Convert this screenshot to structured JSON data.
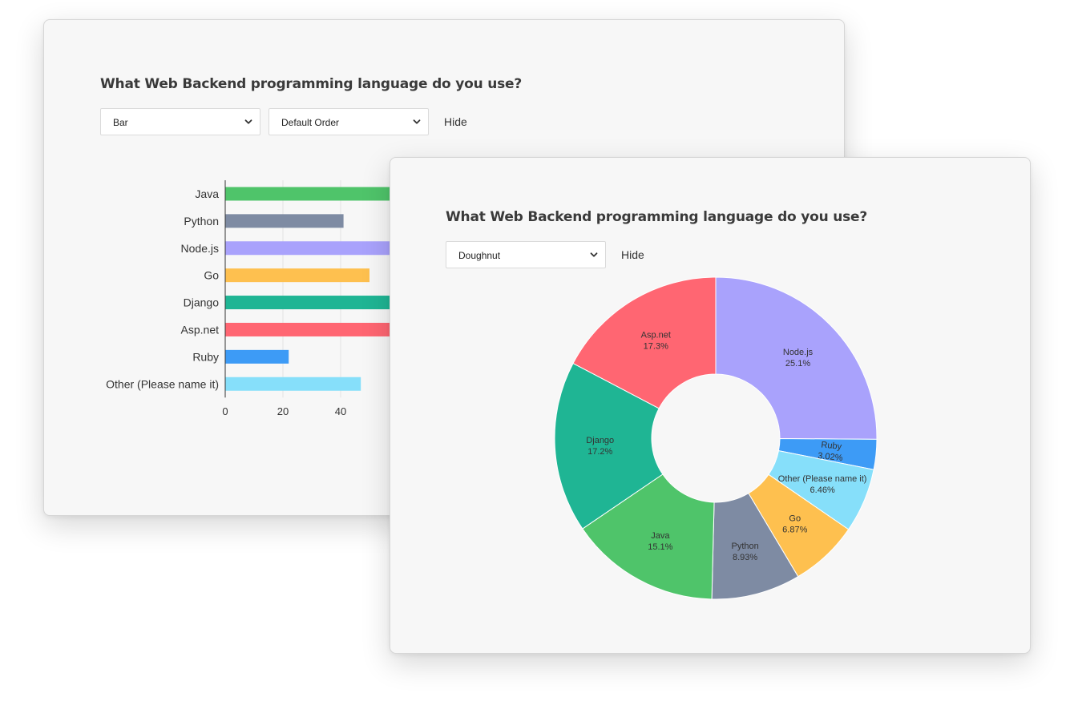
{
  "back_card": {
    "title": "What Web Backend programming language do you use?",
    "chart_type_select": {
      "value": "Bar"
    },
    "order_select": {
      "value": "Default Order"
    },
    "hide_label": "Hide"
  },
  "front_card": {
    "title": "What Web Backend programming language do you use?",
    "chart_type_select": {
      "value": "Doughnut"
    },
    "hide_label": "Hide"
  },
  "icons": {
    "select_arrow": "chevron-down-icon"
  },
  "chart_data": [
    {
      "type": "bar",
      "orientation": "horizontal",
      "title": "",
      "categories": [
        "Java",
        "Python",
        "Node.js",
        "Go",
        "Django",
        "Asp.net",
        "Ruby",
        "Other (Please name it)"
      ],
      "values": [
        70,
        41,
        116,
        50,
        80,
        80,
        22,
        47
      ],
      "colors": [
        "#4fc46a",
        "#7e8ba3",
        "#a9a2fc",
        "#fec04f",
        "#1fb594",
        "#ff6672",
        "#3d9bf6",
        "#86dffa"
      ],
      "x_ticks": [
        "0",
        "20",
        "40"
      ],
      "xlim": [
        0,
        120
      ],
      "grid": true
    },
    {
      "type": "pie",
      "variant": "doughnut",
      "title": "",
      "slices": [
        {
          "label": "Node.js",
          "percent": "25.1%",
          "value": 25.1,
          "color": "#a9a2fc"
        },
        {
          "label": "Ruby",
          "percent": "3.02%",
          "value": 3.02,
          "color": "#3d9bf6"
        },
        {
          "label": "Other (Please name it)",
          "percent": "6.46%",
          "value": 6.46,
          "color": "#86dffa"
        },
        {
          "label": "Go",
          "percent": "6.87%",
          "value": 6.87,
          "color": "#fec04f"
        },
        {
          "label": "Python",
          "percent": "8.93%",
          "value": 8.93,
          "color": "#7e8ba3"
        },
        {
          "label": "Java",
          "percent": "15.1%",
          "value": 15.1,
          "color": "#4fc46a"
        },
        {
          "label": "Django",
          "percent": "17.2%",
          "value": 17.2,
          "color": "#1fb594"
        },
        {
          "label": "Asp.net",
          "percent": "17.3%",
          "value": 17.3,
          "color": "#ff6672"
        }
      ]
    }
  ]
}
